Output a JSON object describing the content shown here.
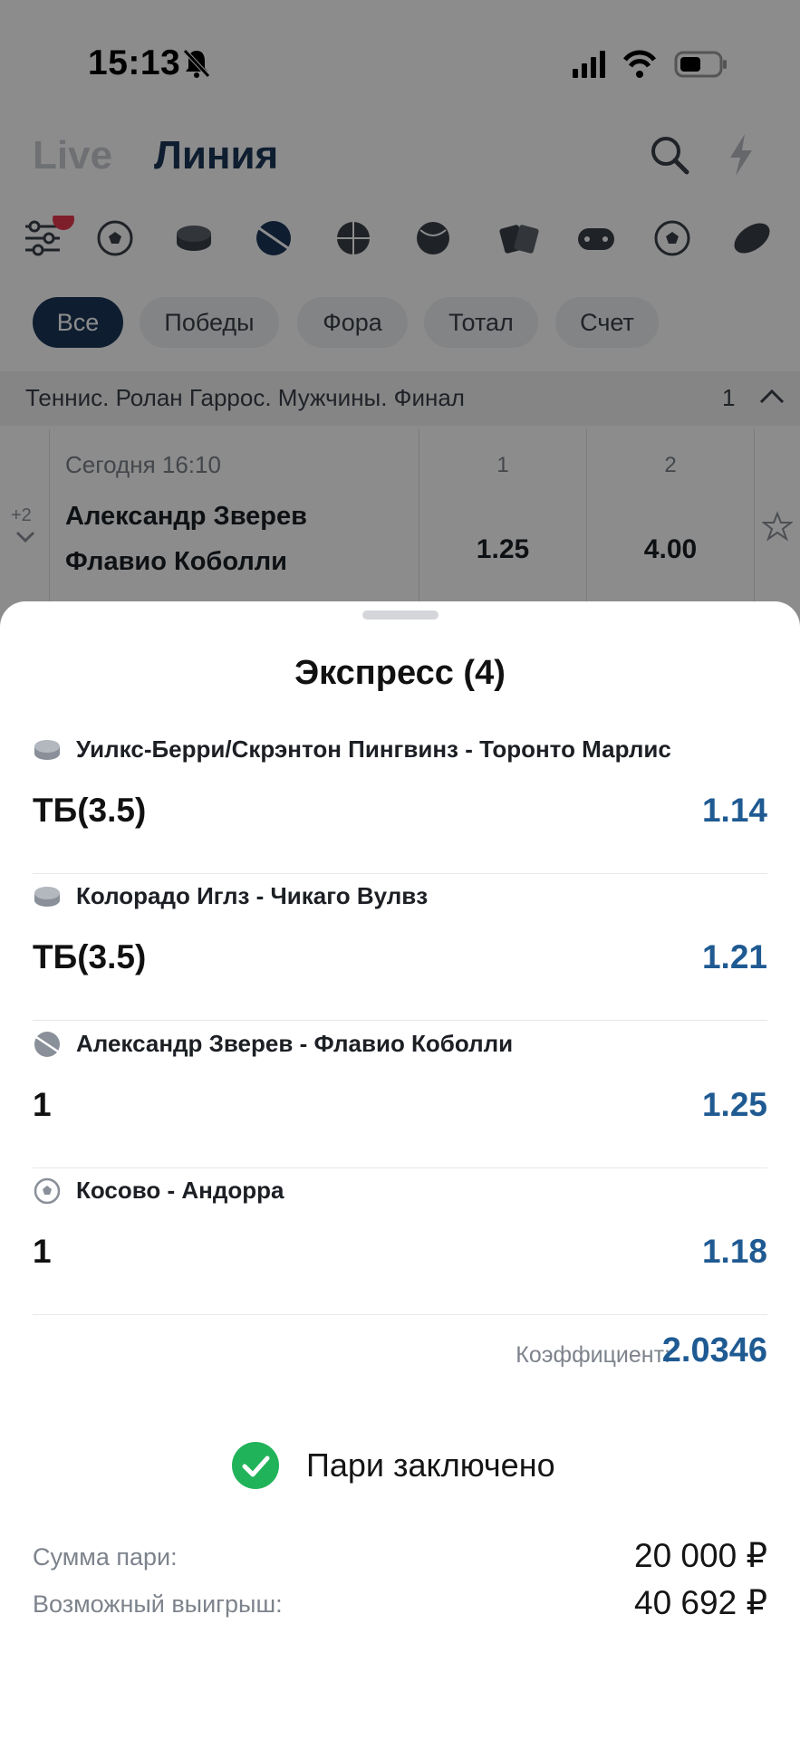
{
  "status_bar": {
    "time": "15:13"
  },
  "nav": {
    "live": "Live",
    "line": "Линия"
  },
  "sports": [
    "filter-icon",
    "soccer-ball-icon",
    "hockey-puck-icon",
    "tennis-ball-icon",
    "basketball-icon",
    "volleyball-icon",
    "cards-icon",
    "gamepad-icon",
    "soccer-ball-icon",
    "rugby-ball-icon"
  ],
  "filters": [
    "Все",
    "Победы",
    "Фора",
    "Тотал",
    "Счет"
  ],
  "league": {
    "title": "Теннис. Ролан Гаррос. Мужчины. Финал",
    "count": "1"
  },
  "match": {
    "date": "Сегодня 16:10",
    "team1": "Александр Зверев",
    "team2": "Флавио Коболли",
    "more": "+2",
    "odds": [
      {
        "label": "1",
        "value": "1.25"
      },
      {
        "label": "2",
        "value": "4.00"
      }
    ]
  },
  "sheet": {
    "title": "Экспресс (4)",
    "bets": [
      {
        "sport_icon": "hockey-puck-icon",
        "event": "Уилкс-Берри/Скрэнтон Пингвинз - Торонто Марлис",
        "market": "ТБ(3.5)",
        "odd": "1.14"
      },
      {
        "sport_icon": "hockey-puck-icon",
        "event": "Колорадо Иглз - Чикаго Вулвз",
        "market": "ТБ(3.5)",
        "odd": "1.21"
      },
      {
        "sport_icon": "tennis-ball-icon",
        "event": "Александр Зверев - Флавио Коболли",
        "market": "1",
        "odd": "1.25"
      },
      {
        "sport_icon": "soccer-ball-icon",
        "event": "Косово - Андорра",
        "market": "1",
        "odd": "1.18"
      }
    ],
    "coefficient_label": "Коэффициент:",
    "coefficient_value": "2.0346",
    "status_text": "Пари заключено",
    "stake_label": "Сумма пари:",
    "stake_value": "20 000 ₽",
    "win_label": "Возможный выигрыш:",
    "win_value": "40 692 ₽"
  },
  "colors": {
    "accent": "#1f5a92",
    "brand": "#1b3558",
    "success": "#21b35a",
    "badge": "#e8384f"
  }
}
